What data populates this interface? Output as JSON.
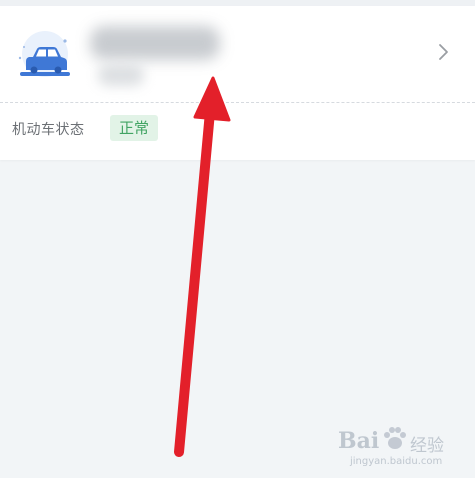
{
  "vehicle": {
    "status_label": "机动车状态",
    "status_value": "正常",
    "icon": "car-icon",
    "chevron_icon": "chevron-right-icon"
  },
  "colors": {
    "status_green": "#41a463",
    "status_bg": "#e2f3e7",
    "car_blue": "#3f78d6",
    "annotation_red": "#e3202a"
  },
  "watermark": {
    "brand": "Bai",
    "cn": "经验",
    "url": "jingyan.baidu.com"
  }
}
